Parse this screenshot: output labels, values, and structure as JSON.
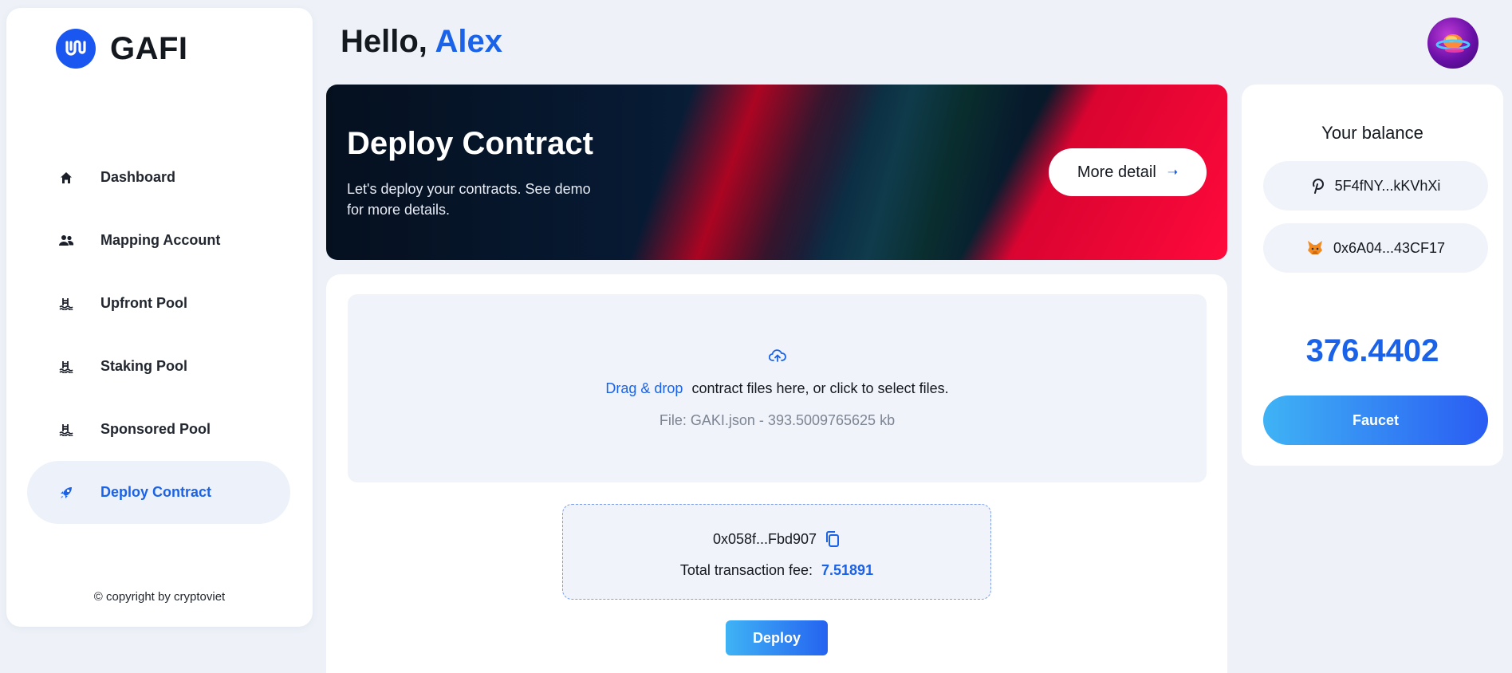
{
  "brand": {
    "name": "GAFI",
    "accent": "#1a63e8"
  },
  "sidebar": {
    "items": [
      {
        "label": "Dashboard",
        "icon": "home-icon"
      },
      {
        "label": "Mapping Account",
        "icon": "people-icon"
      },
      {
        "label": "Upfront Pool",
        "icon": "pool-icon"
      },
      {
        "label": "Staking Pool",
        "icon": "pool-icon"
      },
      {
        "label": "Sponsored Pool",
        "icon": "pool-icon"
      },
      {
        "label": "Deploy Contract",
        "icon": "rocket-icon",
        "active": true
      }
    ],
    "copyright": "© copyright by cryptoviet"
  },
  "header": {
    "greeting": "Hello,",
    "user_name": "Alex"
  },
  "banner": {
    "title": "Deploy Contract",
    "description": "Let's deploy your contracts. See demo for more details.",
    "button_label": "More detail"
  },
  "dropzone": {
    "highlight": "Drag & drop",
    "instruction": "contract files here, or click to select files.",
    "file_info": "File: GAKI.json - 393.5009765625 kb"
  },
  "transaction": {
    "address": "0x058f...Fbd907",
    "fee_label": "Total transaction fee:",
    "fee_value": "7.51891"
  },
  "deploy_button": "Deploy",
  "balance": {
    "title": "Your balance",
    "polkadot_address": "5F4fNY...kKVhXi",
    "metamask_address": "0x6A04...43CF17",
    "amount": "376.4402",
    "faucet_label": "Faucet"
  }
}
